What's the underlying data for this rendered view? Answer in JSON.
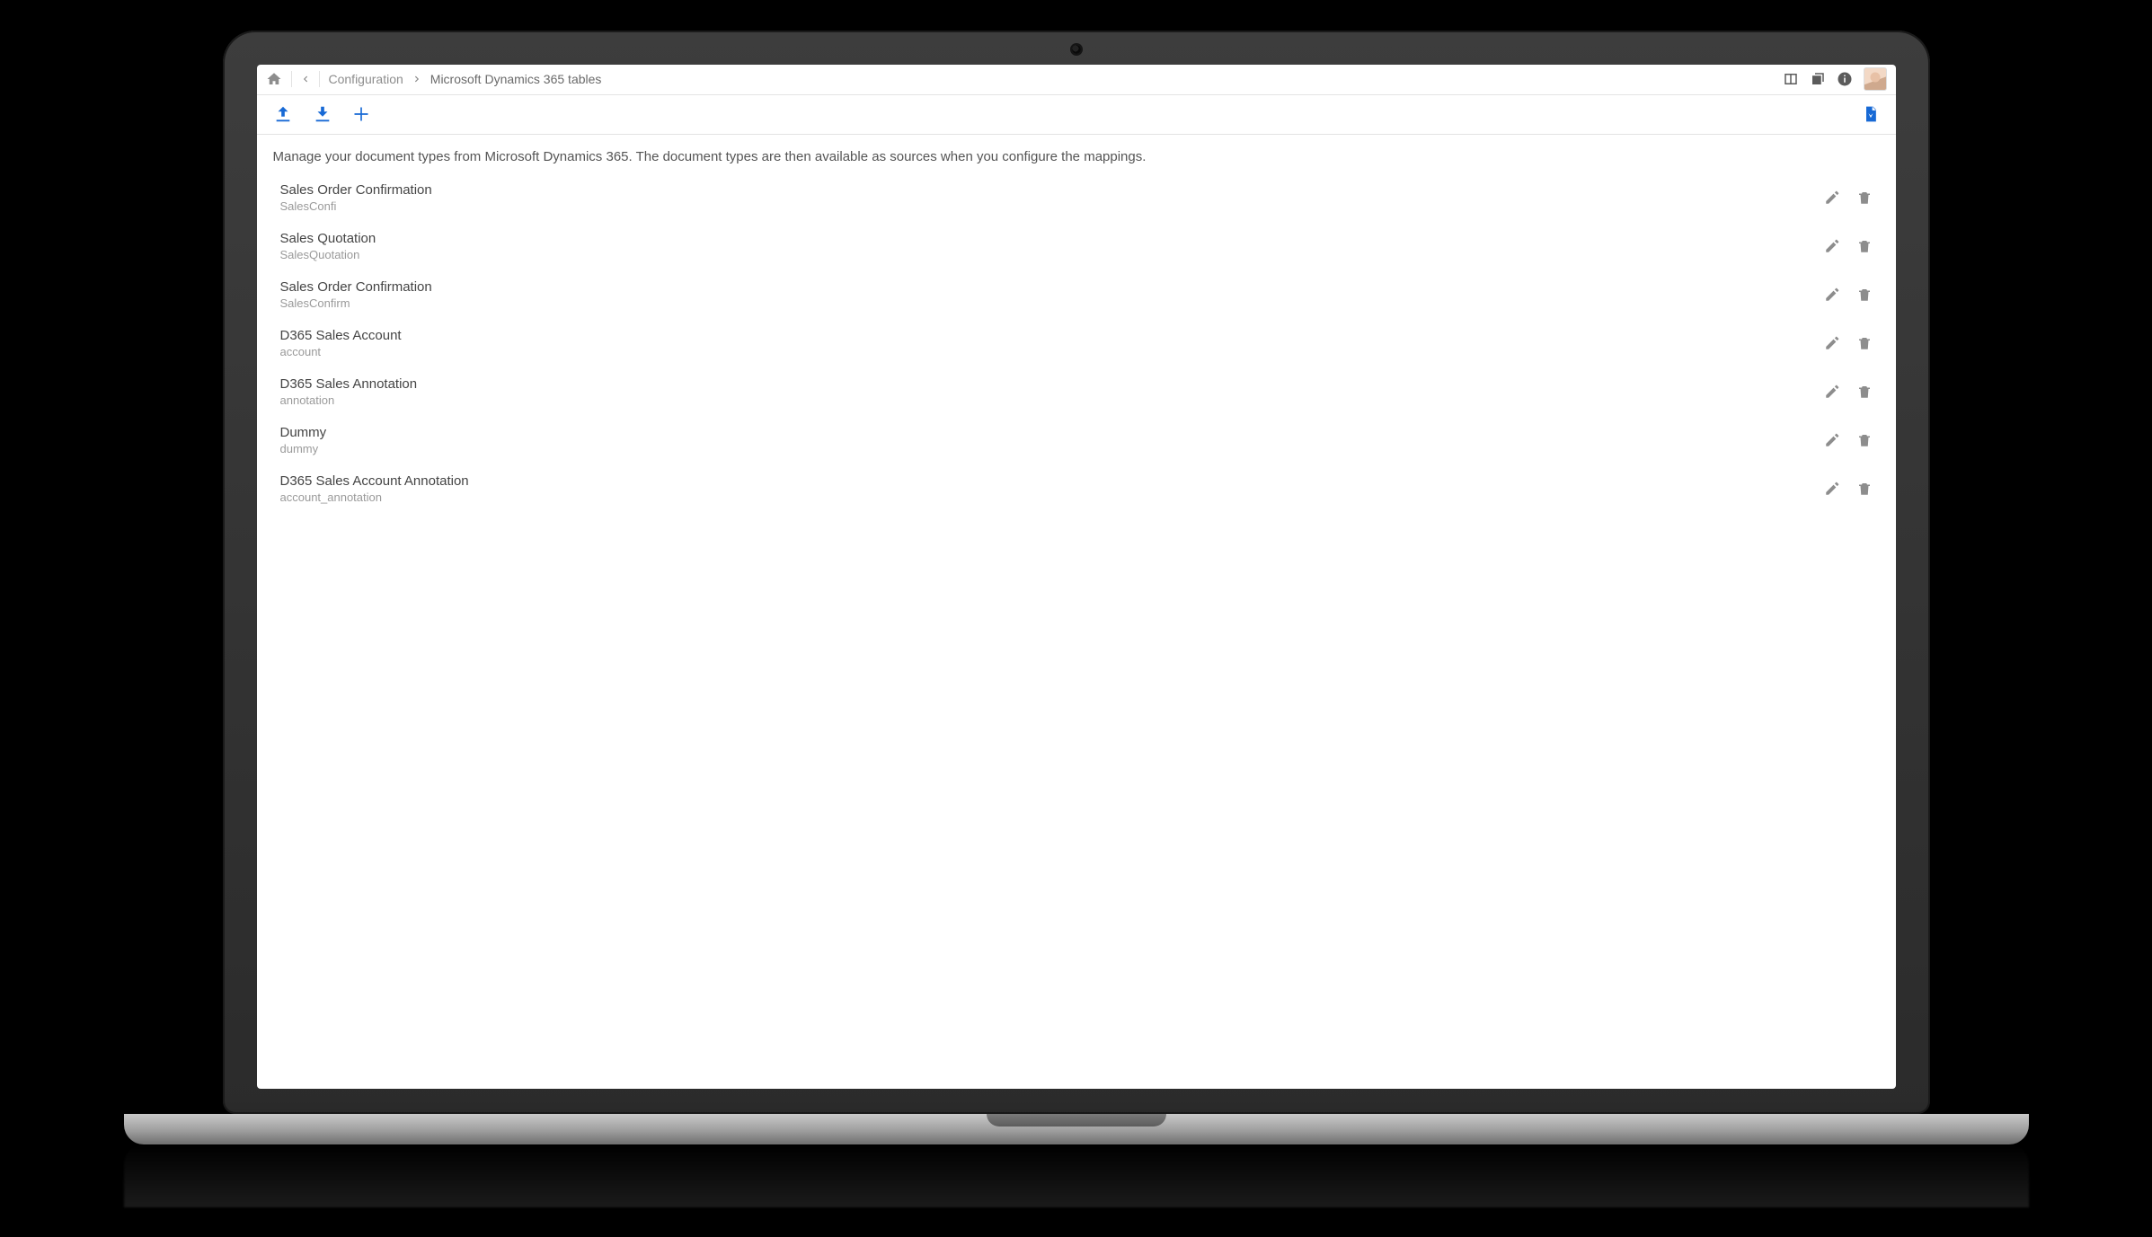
{
  "colors": {
    "accent": "#1769d5"
  },
  "breadcrumbs": {
    "parent": "Configuration",
    "current": "Microsoft Dynamics 365 tables"
  },
  "description": "Manage your document types from Microsoft Dynamics 365. The document types are then available as sources when you configure the mappings.",
  "rows": [
    {
      "title": "Sales Order Confirmation",
      "sub": "SalesConfi"
    },
    {
      "title": "Sales Quotation",
      "sub": "SalesQuotation"
    },
    {
      "title": "Sales Order Confirmation",
      "sub": "SalesConfirm"
    },
    {
      "title": "D365 Sales Account",
      "sub": "account"
    },
    {
      "title": "D365 Sales Annotation",
      "sub": "annotation"
    },
    {
      "title": "Dummy",
      "sub": "dummy"
    },
    {
      "title": "D365 Sales Account Annotation",
      "sub": "account_annotation"
    }
  ]
}
